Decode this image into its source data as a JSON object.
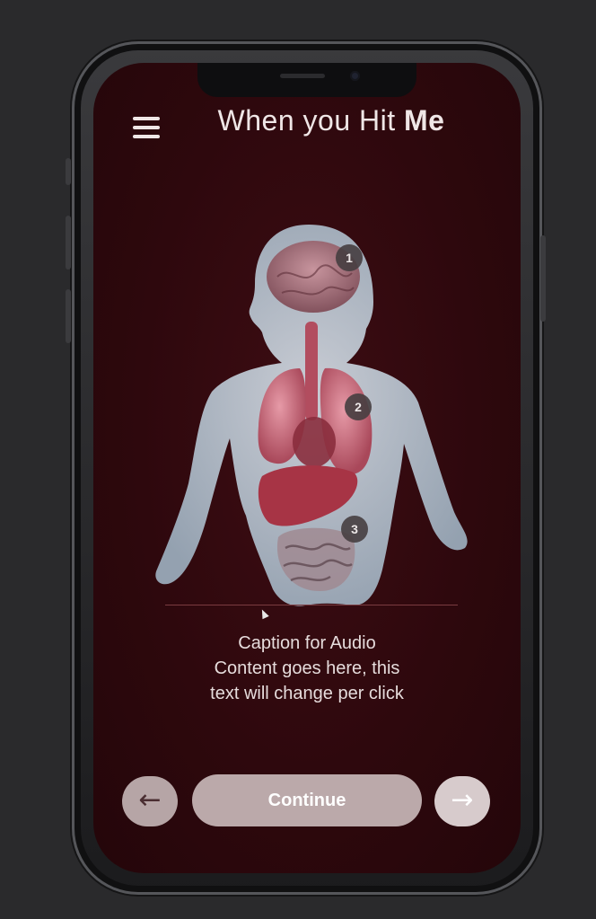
{
  "header": {
    "title_prefix": "When you Hit ",
    "title_emphasis": "Me"
  },
  "figure": {
    "markers": [
      {
        "label": "1"
      },
      {
        "label": "2"
      },
      {
        "label": "3"
      }
    ]
  },
  "caption": {
    "line1": "Caption for Audio",
    "line2": "Content goes here, this",
    "line3": "text will change per click"
  },
  "controls": {
    "prev_icon": "←",
    "continue_label": "Continue",
    "next_icon": "→"
  },
  "icons": {
    "menu": "hamburger-menu-icon",
    "prev": "arrow-left-icon",
    "next": "arrow-right-icon"
  },
  "colors": {
    "screen_background": "#2e080d",
    "button_fill": "#bba9aa",
    "text_light": "#efe6e6"
  }
}
